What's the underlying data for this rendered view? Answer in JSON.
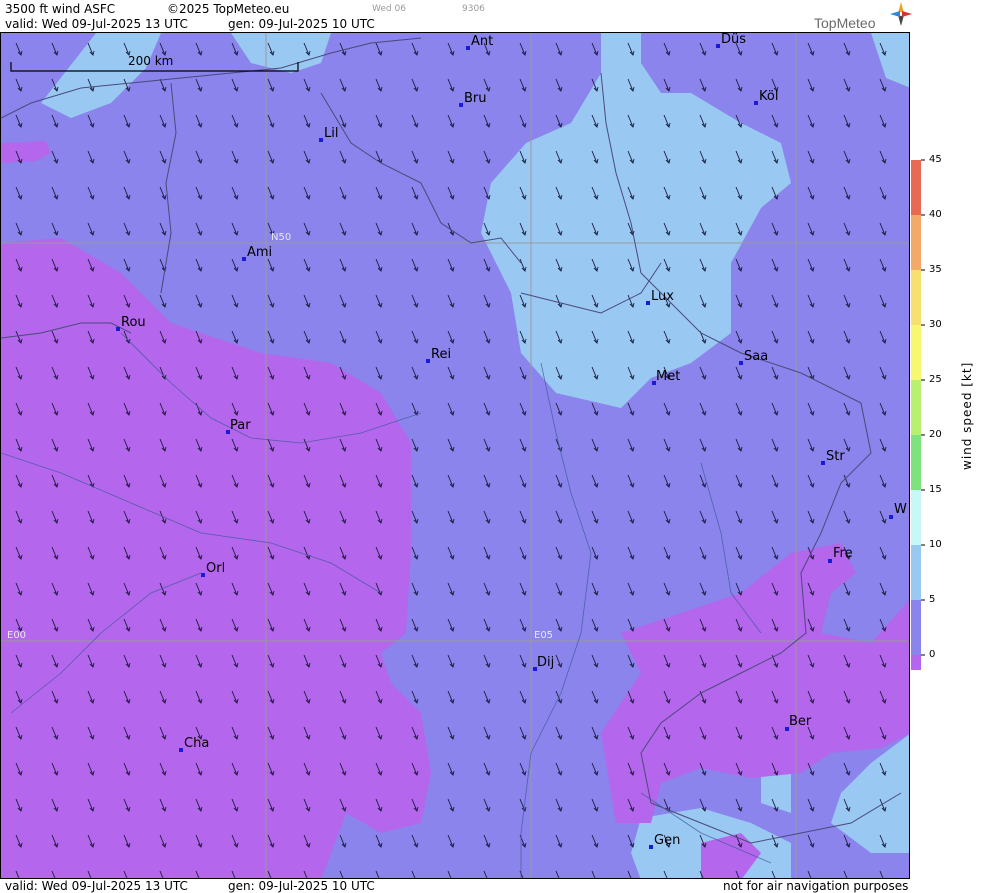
{
  "header": {
    "title": "3500 ft wind ASFC",
    "copyright": "©2025 TopMeteo.eu",
    "small_day": "Wed 06",
    "small_code": "9306",
    "valid": "valid:  Wed  09-Jul-2025  13 UTC",
    "generated": "gen:  09-Jul-2025 10 UTC",
    "logo": "TopMeteo"
  },
  "map": {
    "scale_label": "200 km",
    "grid_labels": {
      "n50": "N50",
      "e00": "E00",
      "e05": "E05"
    },
    "cities": [
      {
        "name": "Ant"
      },
      {
        "name": "Düs"
      },
      {
        "name": "Bru"
      },
      {
        "name": "Köl"
      },
      {
        "name": "Lil"
      },
      {
        "name": "Ami"
      },
      {
        "name": "Rou"
      },
      {
        "name": "Lux"
      },
      {
        "name": "Rei"
      },
      {
        "name": "Saa"
      },
      {
        "name": "Met"
      },
      {
        "name": "Par"
      },
      {
        "name": "Str"
      },
      {
        "name": "W"
      },
      {
        "name": "Fre"
      },
      {
        "name": "Orl"
      },
      {
        "name": "Dij"
      },
      {
        "name": "Ber"
      },
      {
        "name": "Cha"
      },
      {
        "name": "Gen"
      }
    ]
  },
  "legend": {
    "title": "wind speed [kt]",
    "ticks": [
      "45",
      "40",
      "35",
      "30",
      "25",
      "20",
      "15",
      "10",
      "5",
      "0"
    ],
    "colors": [
      "#e86a55",
      "#f3a968",
      "#f7e070",
      "#f8f870",
      "#b8f070",
      "#7ee27e",
      "#c8f7f7",
      "#99c8f3",
      "#8a84ec",
      "#b466ec"
    ]
  },
  "footer": {
    "valid": "valid:  Wed  09-Jul-2025  13 UTC",
    "generated": "gen:  09-Jul-2025 10 UTC",
    "disclaimer": "not for air navigation purposes"
  }
}
